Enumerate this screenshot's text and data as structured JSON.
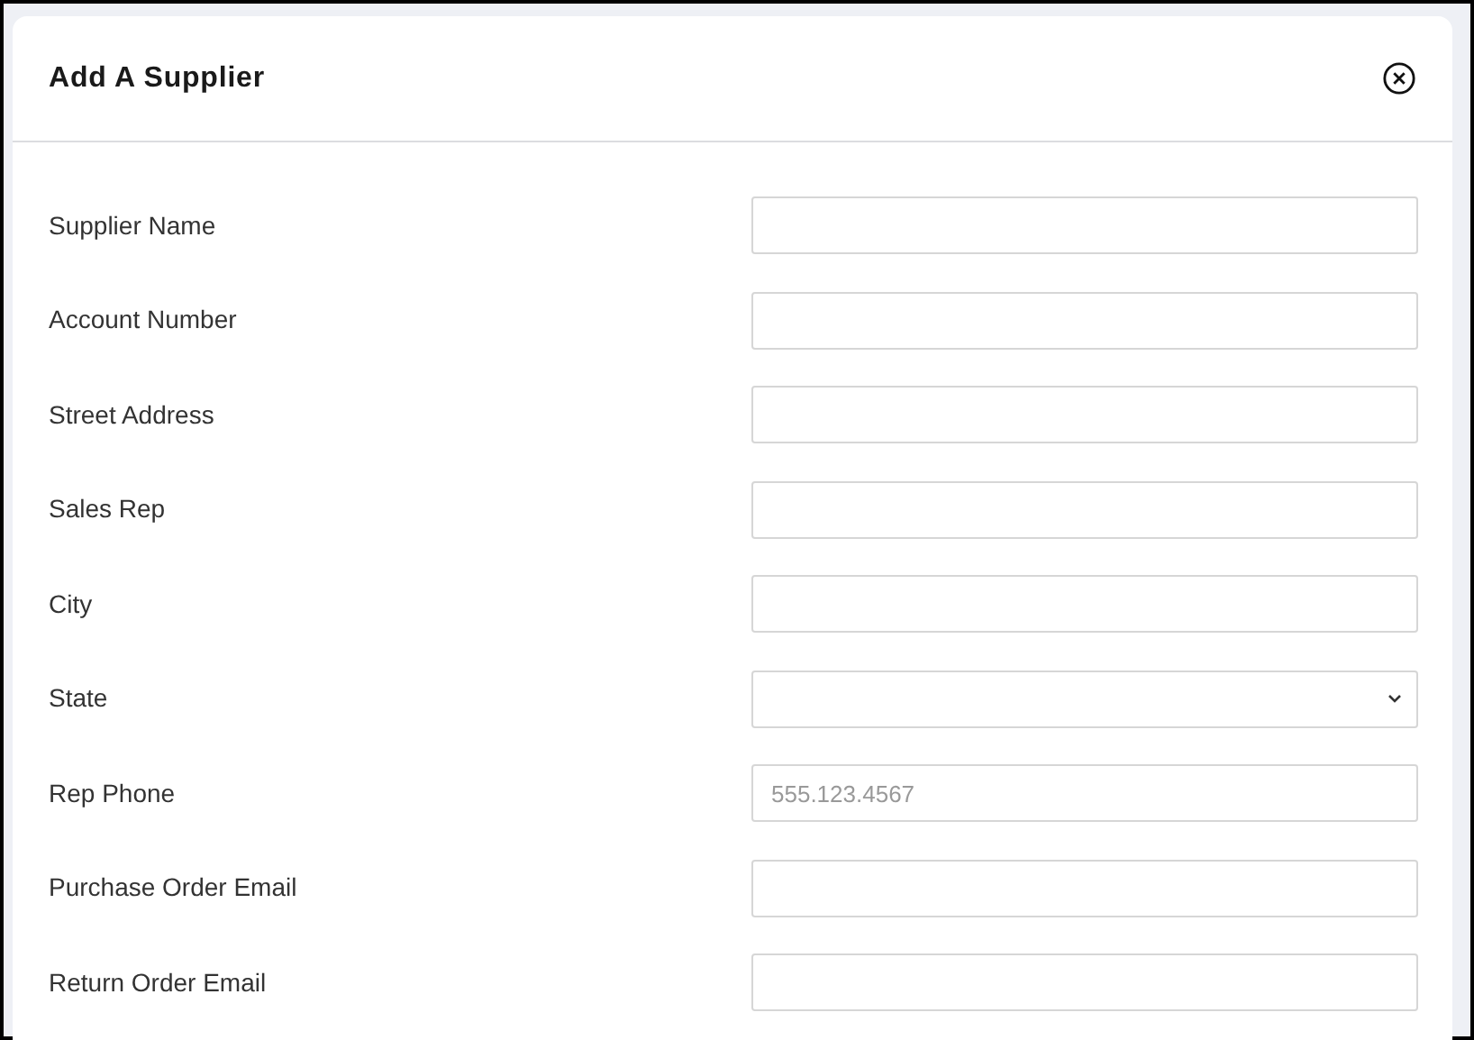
{
  "dialog": {
    "title": "Add A Supplier"
  },
  "fields": [
    {
      "label": "Supplier Name",
      "kind": "text"
    },
    {
      "label": "Account Number",
      "kind": "text"
    },
    {
      "label": "Street Address",
      "kind": "text"
    },
    {
      "label": "Sales Rep",
      "kind": "text"
    },
    {
      "label": "City",
      "kind": "text"
    },
    {
      "label": "State",
      "kind": "select"
    },
    {
      "label": "Rep Phone",
      "kind": "text",
      "placeholder": "555.123.4567"
    },
    {
      "label": "Purchase Order Email",
      "kind": "text"
    },
    {
      "label": "Return Order Email",
      "kind": "text"
    }
  ]
}
